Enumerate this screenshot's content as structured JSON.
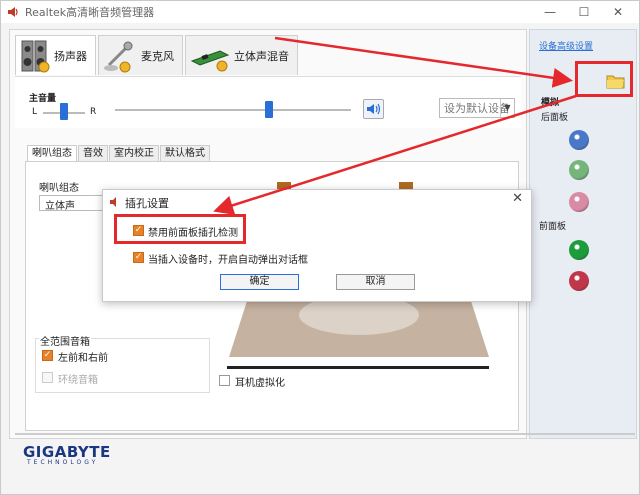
{
  "window": {
    "title": "Realtek高清晰音频管理器",
    "min": "—",
    "max": "☐"
  },
  "device_tabs": [
    {
      "label": "扬声器",
      "icon": "speaker-icon"
    },
    {
      "label": "麦克风",
      "icon": "microphone-icon"
    },
    {
      "label": "立体声混音",
      "icon": "sound-card-icon"
    }
  ],
  "volume": {
    "label": "主音量",
    "left": "L",
    "right": "R",
    "default_device": "设为默认设备"
  },
  "sub_tabs": [
    "喇叭组态",
    "音效",
    "室内校正",
    "默认格式"
  ],
  "speaker_config": {
    "label": "喇叭组态",
    "value": "立体声"
  },
  "fullrange": {
    "label": "全范围音箱",
    "front": "左前和右前",
    "surround": "环绕音箱"
  },
  "headphone": {
    "label": "耳机虚拟化"
  },
  "sidebar": {
    "link": "设备高级设置",
    "analog": "模拟",
    "rear": "后面板",
    "front": "前面板"
  },
  "jacks": {
    "rear": [
      "#4a78c8",
      "#74b57a",
      "#d98aa5"
    ],
    "front": [
      "#1c9c3a",
      "#c2364a"
    ]
  },
  "brand": {
    "name": "GIGABYTE",
    "tagline": "TECHNOLOGY"
  },
  "dialog": {
    "title": "插孔设置",
    "option1": "禁用前面板插孔检测",
    "option2": "当插入设备时，开启自动弹出对话框",
    "ok": "确定",
    "cancel": "取消"
  },
  "colors": {
    "accent": "#2a6fd6",
    "highlight": "#e4282c",
    "check": "#e8822a"
  }
}
